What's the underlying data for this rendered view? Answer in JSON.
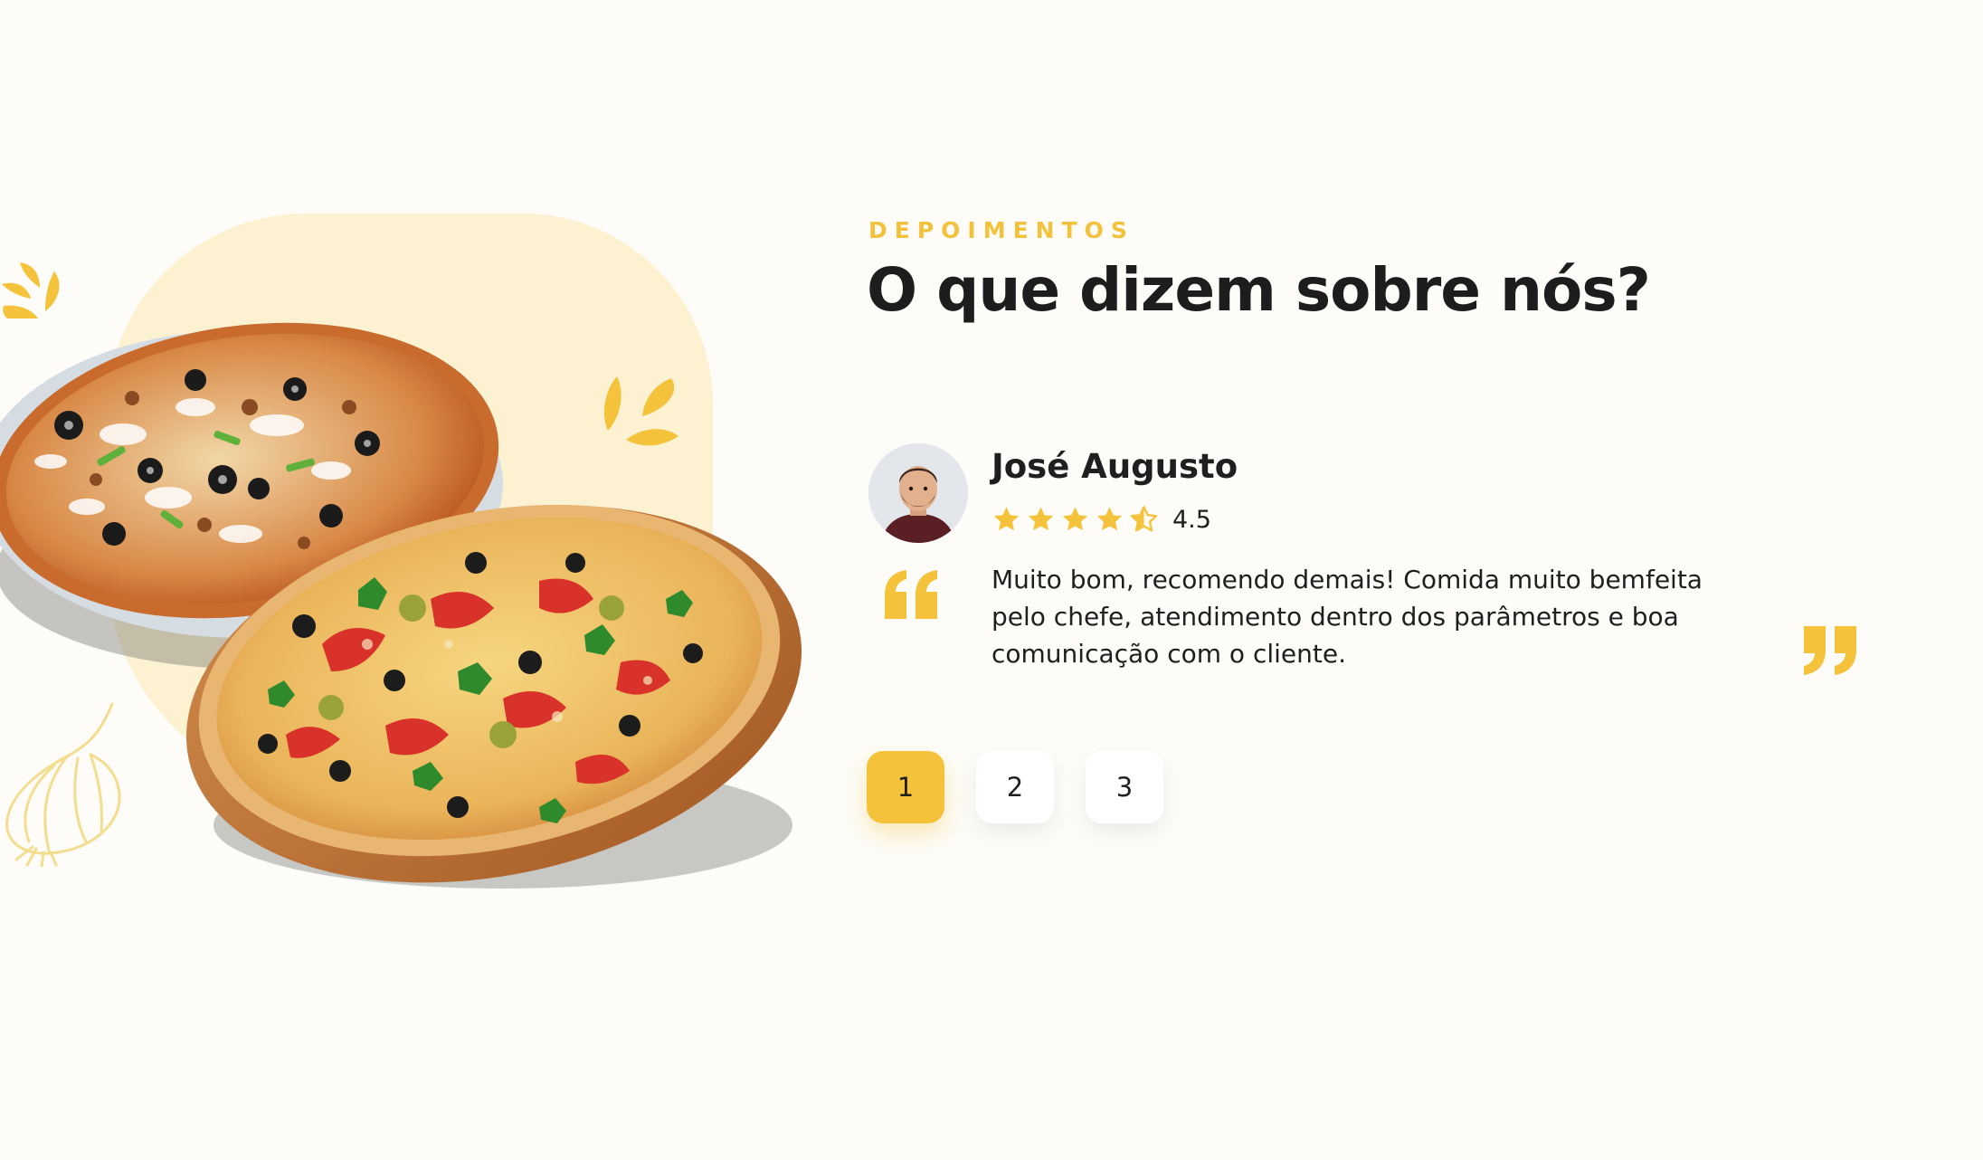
{
  "section": {
    "eyebrow": "DEPOIMENTOS",
    "title": "O que dizem sobre nós?"
  },
  "testimonial": {
    "name": "José Augusto",
    "rating": 4.5,
    "rating_label": "4.5",
    "stars": [
      "star-full-icon",
      "star-full-icon",
      "star-full-icon",
      "star-full-icon",
      "star-half-icon"
    ],
    "text": "Muito bom, recomendo demais! Comida muito bemfeita pelo chefe, atendimento dentro dos parâmetros e boa comunicação com o cliente."
  },
  "pagination": {
    "pages": [
      "1",
      "2",
      "3"
    ],
    "active": "1"
  },
  "colors": {
    "accent": "#f4c33b",
    "heading": "#1d1d1d",
    "background": "#fdfcf8",
    "blob": "#fcf2d2"
  },
  "icons": {
    "quote_open": "quote-open-icon",
    "quote_close": "quote-close-icon",
    "splash": "splash-icon",
    "onion": "onion-icon"
  }
}
